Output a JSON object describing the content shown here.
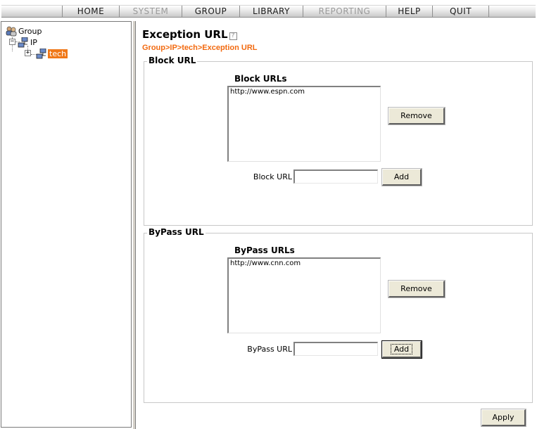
{
  "nav": {
    "items": [
      {
        "label": "HOME",
        "enabled": true
      },
      {
        "label": "SYSTEM",
        "enabled": false
      },
      {
        "label": "GROUP",
        "enabled": true
      },
      {
        "label": "LIBRARY",
        "enabled": true
      },
      {
        "label": "REPORTING",
        "enabled": false
      },
      {
        "label": "HELP",
        "enabled": true
      },
      {
        "label": "QUIT",
        "enabled": true
      }
    ]
  },
  "tree": {
    "root": {
      "label": "Group",
      "icon": "group-icon"
    },
    "ip": {
      "label": "IP",
      "icon": "network-icon",
      "expander": "−"
    },
    "tech": {
      "label": "tech",
      "icon": "network-icon",
      "expander": "+",
      "selected": true
    }
  },
  "page": {
    "title": "Exception URL",
    "help_symbol": "?",
    "breadcrumb": "Group>IP>tech>Exception URL"
  },
  "block": {
    "legend": "Block URL",
    "list_title": "Block URLs",
    "urls": [
      "http://www.espn.com"
    ],
    "remove_label": "Remove",
    "field_label": "Block URL",
    "field_value": "",
    "add_label": "Add"
  },
  "bypass": {
    "legend": "ByPass URL",
    "list_title": "ByPass URLs",
    "urls": [
      "http://www.cnn.com"
    ],
    "remove_label": "Remove",
    "field_label": "ByPass URL",
    "field_value": "",
    "add_label": "Add"
  },
  "apply_label": "Apply",
  "colors": {
    "accent": "#f26a10",
    "selection": "#f07818",
    "disabled_nav": "#9a9a9a"
  }
}
